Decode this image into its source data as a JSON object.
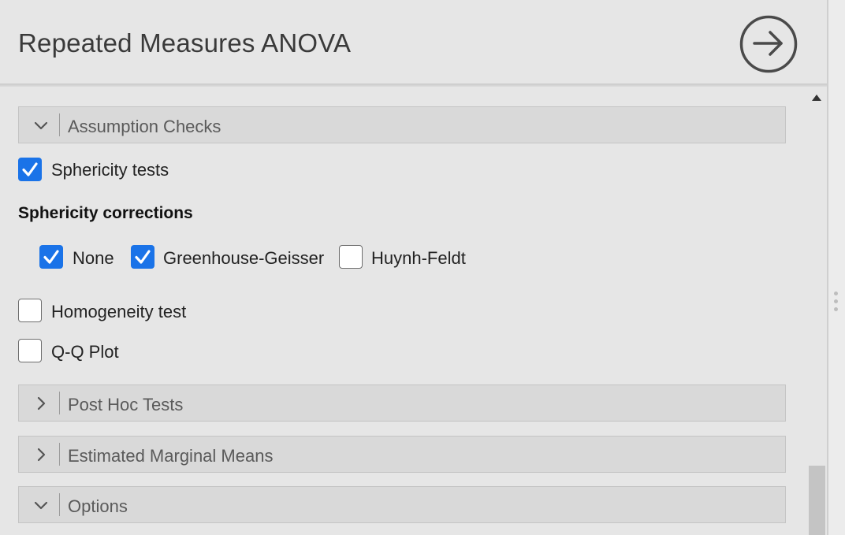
{
  "header": {
    "title": "Repeated Measures ANOVA",
    "run_icon": "arrow-right-circle-icon"
  },
  "sections": {
    "assumption_checks": {
      "label": "Assumption Checks",
      "expanded": true
    },
    "post_hoc": {
      "label": "Post Hoc Tests",
      "expanded": false
    },
    "estimated_marginal_means": {
      "label": "Estimated Marginal Means",
      "expanded": false
    },
    "options": {
      "label": "Options",
      "expanded": true
    }
  },
  "assumption_checks": {
    "sphericity_tests": {
      "label": "Sphericity tests",
      "checked": true
    },
    "corrections_title": "Sphericity corrections",
    "corrections": [
      {
        "label": "None",
        "checked": true
      },
      {
        "label": "Greenhouse-Geisser",
        "checked": true
      },
      {
        "label": "Huynh-Feldt",
        "checked": false
      }
    ],
    "homogeneity_test": {
      "label": "Homogeneity test",
      "checked": false
    },
    "qq_plot": {
      "label": "Q-Q Plot",
      "checked": false
    }
  },
  "colors": {
    "accent": "#1a73e8",
    "panel_bg": "#e6e6e6",
    "section_bg": "#d9d9d9"
  }
}
